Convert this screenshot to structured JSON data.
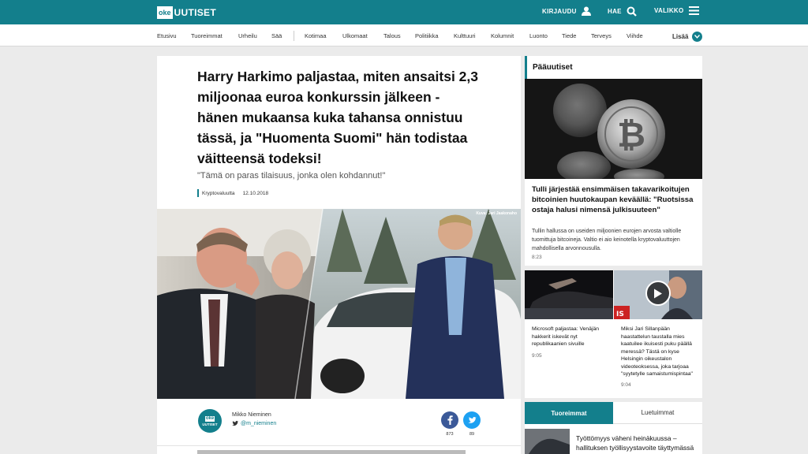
{
  "header": {
    "logo_box": "oke",
    "logo_text": "UUTISET",
    "login_label": "KIRJAUDU",
    "search_label": "HAE",
    "menu_label": "VALIKKO",
    "accent_color": "#137f8c"
  },
  "nav": {
    "items": [
      "Etusivu",
      "Tuoreimmat",
      "Urheilu",
      "Sää",
      "Kotimaa",
      "Ulkomaat",
      "Talous",
      "Politiikka",
      "Kulttuuri",
      "Kolumnit",
      "Luonto",
      "Tiede",
      "Terveys",
      "Viihde"
    ],
    "more_label": "Lisää"
  },
  "article": {
    "headline": "Harry Harkimo paljastaa, miten ansaitsi 2,3 miljoonaa euroa konkurssin jälkeen - hänen mukaansa kuka tahansa onnistuu tässä, ja \"Huomenta Suomi\" hän todistaa väitteensä todeksi!",
    "subhead": "\"Tämä on paras tilaisuus, jonka olen kohdannut!\"",
    "category": "Kryptovaluutta",
    "date": "12.10.2018",
    "photo_credit": "Kuva: Jari Jaakonaho",
    "author_logo_top": "oke",
    "author_logo_bottom": "UUTISET",
    "author_name": "Mikko Nieminen",
    "author_handle": "@m_nieminen",
    "facebook_count": "873",
    "twitter_count": "89"
  },
  "sidebar": {
    "title": "Pääuutiset",
    "hero_title": "Tulli järjestää ensimmäisen takavarikoitujen bitcoinien huutokaupan keväällä: \"Ruotsissa ostaja halusi nimensä julkisuuteen\"",
    "hero_desc": "Tullin hallussa on useiden miljoonien eurojen arvosta valtiolle tuomittuja bitcoineja. Valtio ei aio keinotella kryptovaluuttojen mahdollisella arvonnousulla.",
    "hero_time": "8:23",
    "small_items": [
      {
        "text": "Microsoft paljastaa: Venäjän hakkerit iskevät nyt republikaanien sivuille",
        "time": "9:05"
      },
      {
        "text": "Miksi Jari Sillanpään haastattelun taustalla mies kaatuilee ikuisesti puku päällä meressä? Tästä on kyse Helsingin oikeustalon videoteoksessa, joka tarjoaa \"syytetylle samaistumispintaa\"",
        "time": "9:04"
      }
    ]
  },
  "tabs": {
    "active": "Tuoreimmat",
    "other": "Luetuimmat",
    "first_item": "Työttömyys väheni heinäkuussa – hallituksen työllisyystavoite täyttymässä"
  }
}
